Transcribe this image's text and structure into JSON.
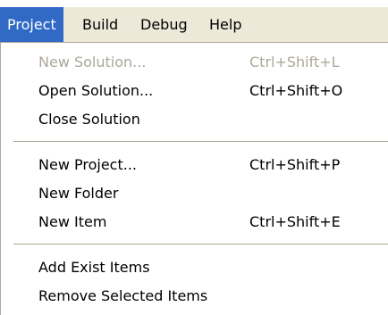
{
  "menubar": {
    "items": [
      {
        "label": "Project"
      },
      {
        "label": "Build"
      },
      {
        "label": "Debug"
      },
      {
        "label": "Help"
      }
    ]
  },
  "project_menu": {
    "groups": [
      [
        {
          "label": "New Solution...",
          "shortcut": "Ctrl+Shift+L",
          "enabled": false
        },
        {
          "label": "Open Solution...",
          "shortcut": "Ctrl+Shift+O",
          "enabled": true
        },
        {
          "label": "Close Solution",
          "shortcut": "",
          "enabled": true
        }
      ],
      [
        {
          "label": "New Project...",
          "shortcut": "Ctrl+Shift+P",
          "enabled": true
        },
        {
          "label": "New Folder",
          "shortcut": "",
          "enabled": true
        },
        {
          "label": "New Item",
          "shortcut": "Ctrl+Shift+E",
          "enabled": true
        }
      ],
      [
        {
          "label": "Add Exist Items",
          "shortcut": "",
          "enabled": true
        },
        {
          "label": "Remove Selected Items",
          "shortcut": "",
          "enabled": true
        }
      ]
    ]
  },
  "colors": {
    "menubar_bg": "#ece9d8",
    "highlight": "#316ac5",
    "disabled_text": "#aca899",
    "separator": "#aca899"
  }
}
